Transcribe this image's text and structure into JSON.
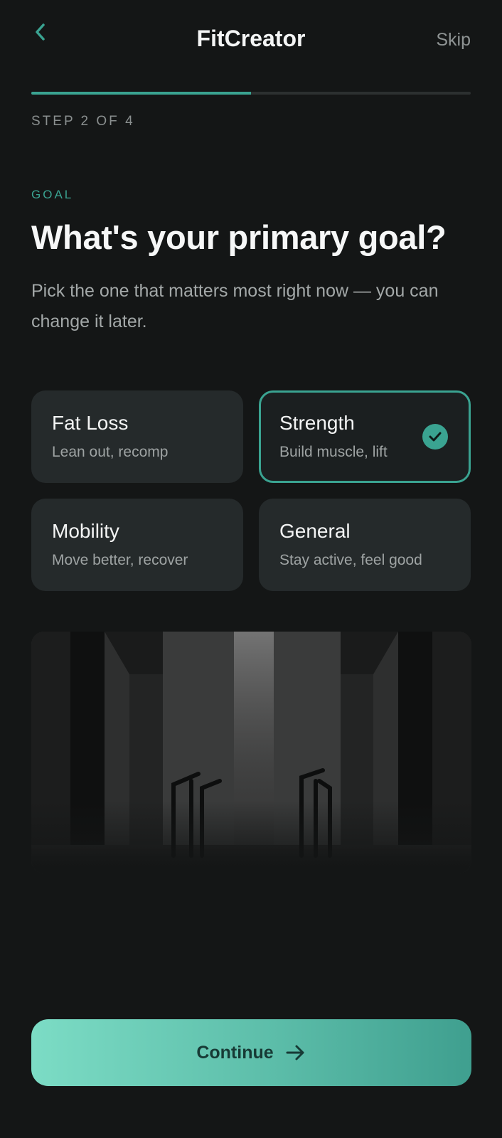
{
  "header": {
    "title": "FitCreator",
    "skip_label": "Skip",
    "back_icon": "chevron-left-icon"
  },
  "progress": {
    "step_label": "STEP 2 OF 4",
    "current_step": 2,
    "total_steps": 4,
    "fraction": 0.5
  },
  "question": {
    "eyebrow": "GOAL",
    "title": "What's your primary goal?",
    "subtitle": "Pick the one that matters most right now — you can change it later."
  },
  "goals": [
    {
      "title": "Fat Loss",
      "description": "Lean out, recomp",
      "selected": false
    },
    {
      "title": "Strength",
      "description": "Build muscle, lift",
      "selected": true
    },
    {
      "title": "Mobility",
      "description": "Move better, recover",
      "selected": false
    },
    {
      "title": "General",
      "description": "Stay active, feel good",
      "selected": false
    }
  ],
  "hero_image": {
    "icon": "gym-photo"
  },
  "footer": {
    "continue_label": "Continue",
    "continue_icon": "arrow-right-icon"
  },
  "colors": {
    "background": "#141616",
    "accent": "#3aa391",
    "card": "#252a2b",
    "button_gradient_start": "#7cdcc5",
    "button_gradient_end": "#3f9f8f"
  }
}
